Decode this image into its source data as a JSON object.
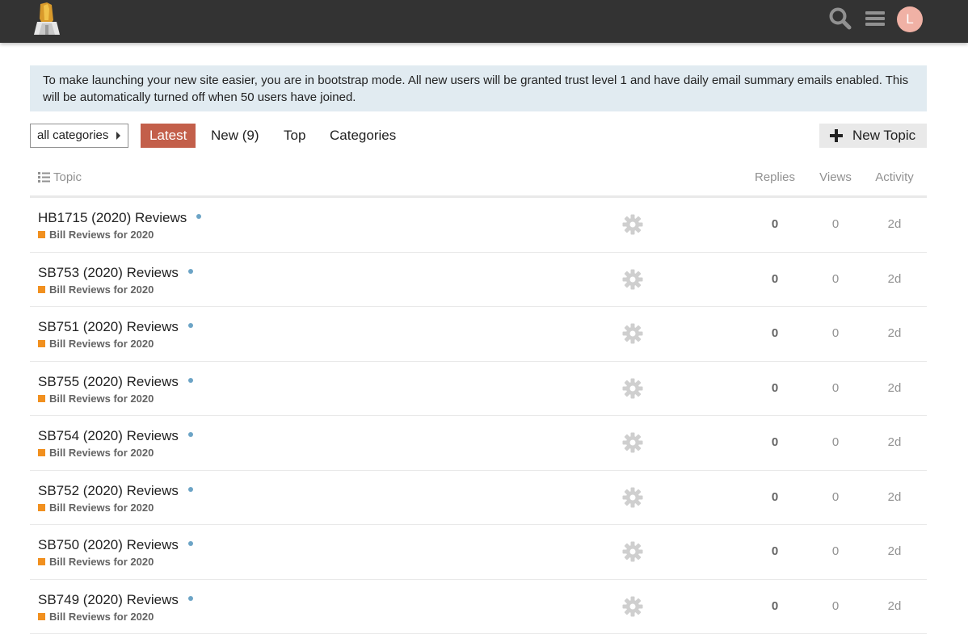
{
  "header": {
    "avatar_letter": "L",
    "avatar_color": "#f0b1a5",
    "bg_color": "#333333"
  },
  "banner": {
    "text": "To make launching your new site easier, you are in bootstrap mode. All new users will be granted trust level 1 and have daily email summary emails enabled. This will be automatically turned off when 50 users have joined."
  },
  "nav": {
    "category_dropdown": "all categories",
    "tabs": [
      "Latest",
      "New (9)",
      "Top",
      "Categories"
    ],
    "active_tab": "Latest",
    "new_topic_label": "New Topic",
    "accent_color": "#c35f4a"
  },
  "table": {
    "columns": {
      "topic": "Topic",
      "replies": "Replies",
      "views": "Views",
      "activity": "Activity"
    },
    "category_color": "#f1901f",
    "rows": [
      {
        "title": "HB1715 (2020) Reviews",
        "category": "Bill Reviews for 2020",
        "replies": "0",
        "views": "0",
        "activity": "2d"
      },
      {
        "title": "SB753 (2020) Reviews",
        "category": "Bill Reviews for 2020",
        "replies": "0",
        "views": "0",
        "activity": "2d"
      },
      {
        "title": "SB751 (2020) Reviews",
        "category": "Bill Reviews for 2020",
        "replies": "0",
        "views": "0",
        "activity": "2d"
      },
      {
        "title": "SB755 (2020) Reviews",
        "category": "Bill Reviews for 2020",
        "replies": "0",
        "views": "0",
        "activity": "2d"
      },
      {
        "title": "SB754 (2020) Reviews",
        "category": "Bill Reviews for 2020",
        "replies": "0",
        "views": "0",
        "activity": "2d"
      },
      {
        "title": "SB752 (2020) Reviews",
        "category": "Bill Reviews for 2020",
        "replies": "0",
        "views": "0",
        "activity": "2d"
      },
      {
        "title": "SB750 (2020) Reviews",
        "category": "Bill Reviews for 2020",
        "replies": "0",
        "views": "0",
        "activity": "2d"
      },
      {
        "title": "SB749 (2020) Reviews",
        "category": "Bill Reviews for 2020",
        "replies": "0",
        "views": "0",
        "activity": "2d"
      }
    ]
  }
}
